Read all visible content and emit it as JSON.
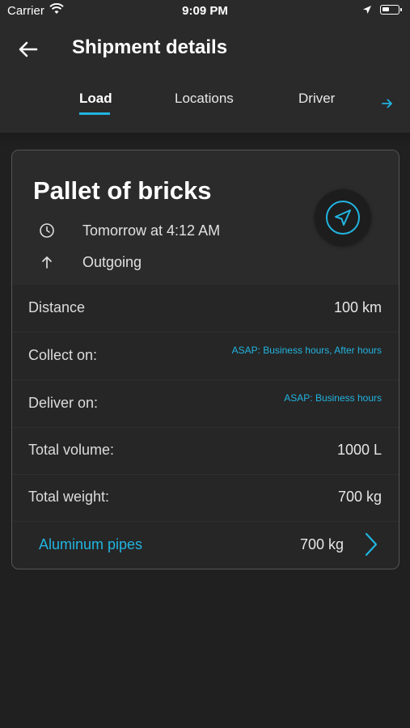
{
  "status_bar": {
    "carrier": "Carrier",
    "time": "9:09 PM",
    "icons": [
      "wifi-icon",
      "location-arrow-icon",
      "battery-icon"
    ]
  },
  "header": {
    "title": "Shipment details",
    "back_icon": "arrow-left-icon"
  },
  "tabs": [
    {
      "label": "Load",
      "active": true
    },
    {
      "label": "Locations",
      "active": false
    },
    {
      "label": "Driver",
      "active": false
    }
  ],
  "tabs_more_icon": "arrow-right-icon",
  "card": {
    "title": "Pallet of bricks",
    "time": "Tomorrow at 4:12 AM",
    "direction": "Outgoing",
    "nav_button_icon": "navigation-arrow-icon",
    "rows": [
      {
        "label": "Distance",
        "value": "100 km"
      },
      {
        "label": "Collect on:",
        "value": "ASAP: Business hours, After hours"
      },
      {
        "label": "Deliver on:",
        "value": "ASAP: Business hours"
      },
      {
        "label": "Total volume:",
        "value": "1000 L"
      },
      {
        "label": "Total weight:",
        "value": "700 kg"
      }
    ],
    "item": {
      "name": "Aluminum pipes",
      "weight": "700 kg"
    }
  },
  "colors": {
    "accent": "#21b4e0",
    "background": "#202020",
    "appbar": "#2a2a2a"
  }
}
